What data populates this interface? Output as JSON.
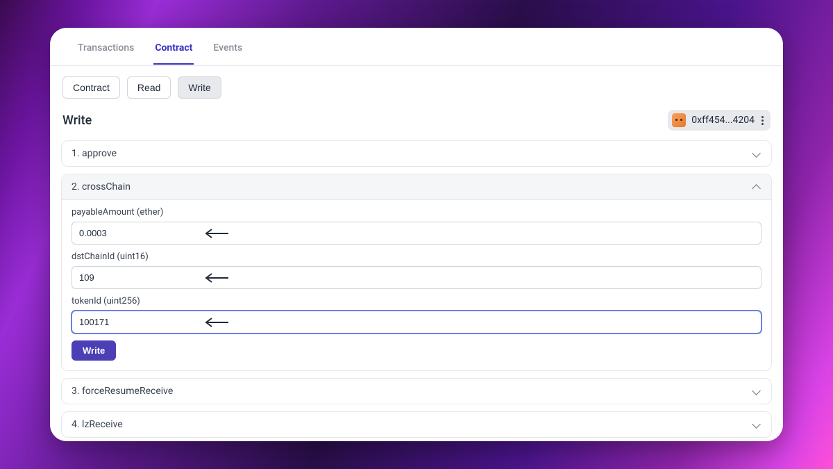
{
  "tabs": {
    "items": [
      "Transactions",
      "Contract",
      "Events"
    ],
    "activeIndex": 1
  },
  "subtabs": {
    "items": [
      "Contract",
      "Read",
      "Write"
    ],
    "activeIndex": 2
  },
  "section": {
    "title": "Write"
  },
  "wallet": {
    "address_short": "0xff454...4204"
  },
  "functions": [
    {
      "index": "1",
      "name": "approve",
      "expanded": false
    },
    {
      "index": "2",
      "name": "crossChain",
      "expanded": true,
      "fields": [
        {
          "label": "payableAmount (ether)",
          "value": "0.0003"
        },
        {
          "label": "dstChainId (uint16)",
          "value": "109"
        },
        {
          "label": "tokenId (uint256)",
          "value": "100171",
          "focused": true
        }
      ],
      "action_label": "Write"
    },
    {
      "index": "3",
      "name": "forceResumeReceive",
      "expanded": false
    },
    {
      "index": "4",
      "name": "lzReceive",
      "expanded": false
    }
  ]
}
